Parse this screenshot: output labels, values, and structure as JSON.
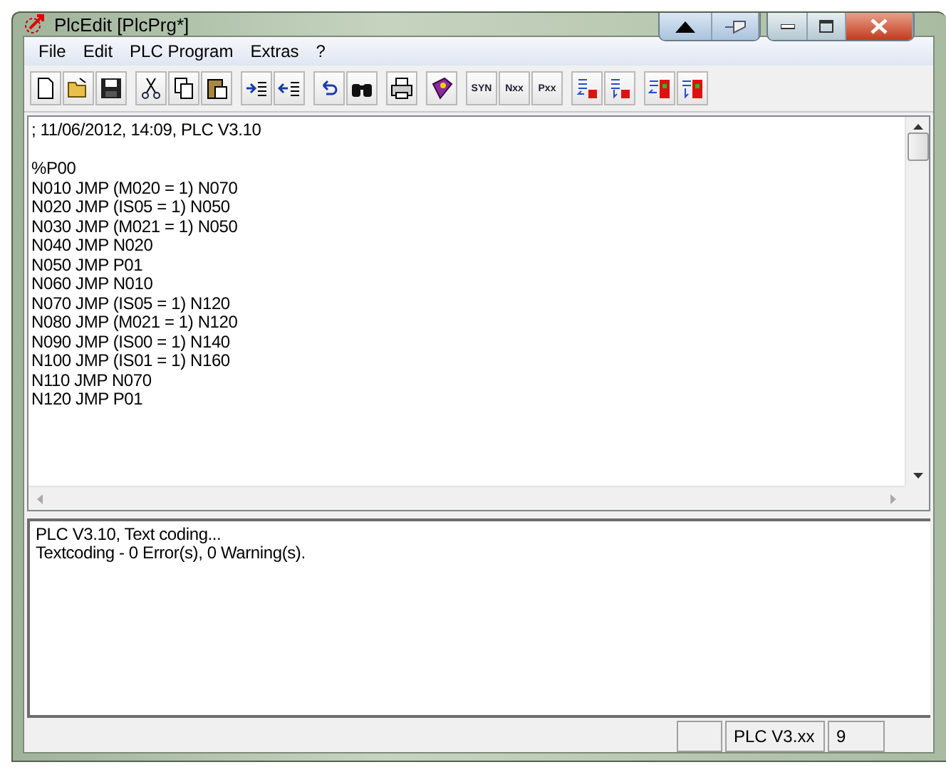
{
  "window": {
    "title": "PlcEdit [PlcPrg*]"
  },
  "menu": [
    "File",
    "Edit",
    "PLC Program",
    "Extras",
    "?"
  ],
  "toolbar": {
    "text_icons": [
      "SYN",
      "Nxx",
      "Pxx"
    ]
  },
  "editor": {
    "paragraphs": [
      [
        "; 11/06/2012, 14:09, PLC V3.10"
      ],
      [
        "%P00",
        "N010 JMP (M020 = 1) N070",
        "N020 JMP (IS05 = 1) N050",
        "N030 JMP (M021 = 1) N050",
        "N040 JMP N020",
        "N050 JMP P01",
        "N060 JMP N010",
        "N070 JMP (IS05 = 1) N120",
        "N080 JMP (M021 = 1) N120",
        "N090 JMP (IS00 = 1) N140",
        "N100 JMP (IS01 = 1) N160",
        "N110 JMP N070",
        "N120 JMP P01"
      ]
    ]
  },
  "output": {
    "lines": [
      "PLC V3.10, Text coding...",
      "Textcoding - 0 Error(s), 0 Warning(s)."
    ]
  },
  "status_bar": {
    "panels": [
      "PLC V3.xx",
      "9"
    ]
  }
}
